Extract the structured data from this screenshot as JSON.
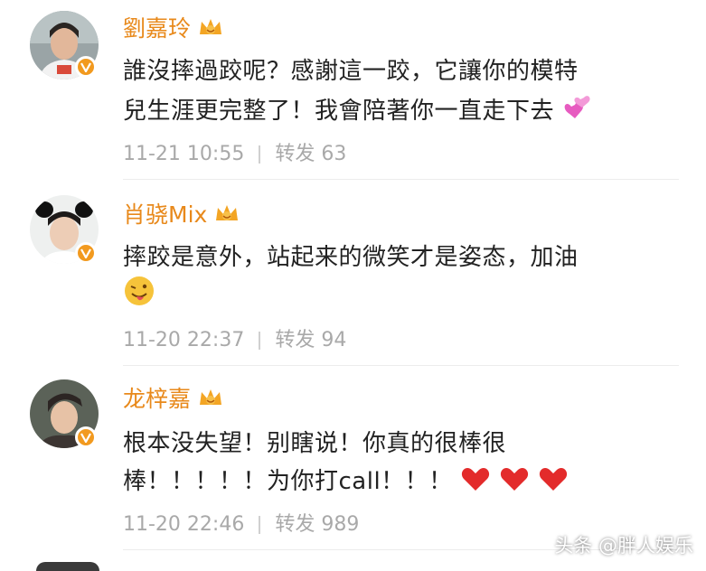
{
  "comments": [
    {
      "username": "劉嘉玲",
      "lines": [
        "誰沒摔過跤呢？感謝這一跤，它讓你的模特",
        "兒生涯更完整了！我會陪著你一直走下去"
      ],
      "time": "11-21 10:55",
      "repost_label": "转发",
      "repost_count": "63",
      "trailing_emoji": "two-hearts-icon"
    },
    {
      "username": "肖骁Mix",
      "lines": [
        "摔跤是意外，站起来的微笑才是姿态，加油"
      ],
      "time": "11-20 22:37",
      "repost_label": "转发",
      "repost_count": "94",
      "trailing_emoji": "tongue-face-icon"
    },
    {
      "username": "龙梓嘉",
      "lines": [
        "根本没失望！别瞎说！你真的很棒很",
        "棒！！！！！为你打call！！！"
      ],
      "time": "11-20 22:46",
      "repost_label": "转发",
      "repost_count": "989",
      "trailing_emoji": "red-heart-icon"
    }
  ],
  "watermark": "头条 @胖人娱乐",
  "colors": {
    "username": "#e8891b",
    "text": "#222222",
    "meta": "#a9a9a9",
    "verified_badge": "#f29a1f",
    "heart": "#e32b2b"
  }
}
